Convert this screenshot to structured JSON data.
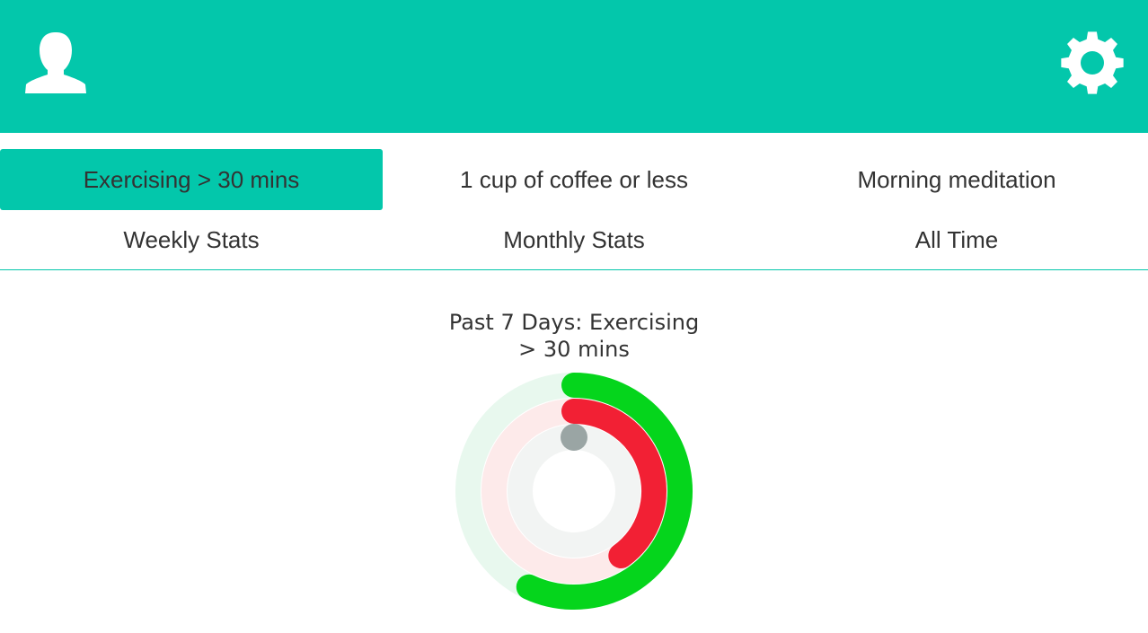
{
  "header": {
    "background_color": "#03c7ab",
    "profile_icon": "user-silhouette-icon",
    "settings_icon": "gear-icon"
  },
  "habits": {
    "tabs": [
      {
        "label": "Exercising > 30 mins",
        "active": true
      },
      {
        "label": "1 cup of coffee or less",
        "active": false
      },
      {
        "label": "Morning meditation",
        "active": false
      }
    ]
  },
  "stats": {
    "tabs": [
      {
        "label": "Weekly Stats"
      },
      {
        "label": "Monthly Stats"
      },
      {
        "label": "All Time"
      }
    ]
  },
  "chart": {
    "title_line1": "Past 7 Days: Exercising",
    "title_line2": "> 30 mins",
    "rings": [
      {
        "ring": "outer",
        "color": "#05d51c",
        "track_color": "#e8f8ee",
        "progress": 0.57
      },
      {
        "ring": "middle",
        "color": "#f22034",
        "track_color": "#fdeaea",
        "progress": 0.4
      },
      {
        "ring": "inner",
        "color": "#9aa5a4",
        "track_color": "#f2f4f3",
        "progress": 0.0
      }
    ]
  }
}
